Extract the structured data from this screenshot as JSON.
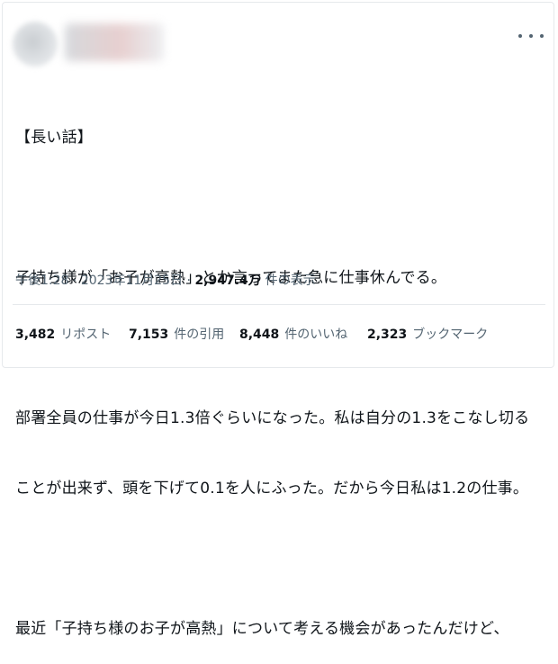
{
  "header": {
    "more_icon": "more-horizontal-icon"
  },
  "tweet": {
    "lines": [
      "【長い話】",
      "",
      "子持ち様が「お子が高熱」とか言ってまた急に仕事休んでる。",
      "",
      "部署全員の仕事が今日1.3倍ぐらいになった。私は自分の1.3をこなし切る",
      "ことが出来ず、頭を下げて0.1を人にふった。だから今日私は1.2の仕事。",
      "",
      "最近「子持ち様のお子が高熱」について考える機会があったんだけど、"
    ]
  },
  "meta": {
    "time": "午後1:28",
    "date": "2023年11月25日",
    "separator": "·",
    "views_count": "2,947.4万",
    "views_label": "件の表示"
  },
  "stats": {
    "reposts_count": "3,482",
    "reposts_label": "リポスト",
    "quotes_count": "7,153",
    "quotes_label": "件の引用",
    "likes_count": "8,448",
    "likes_label": "件のいいね",
    "bookmarks_count": "2,323",
    "bookmarks_label": "ブックマーク"
  }
}
